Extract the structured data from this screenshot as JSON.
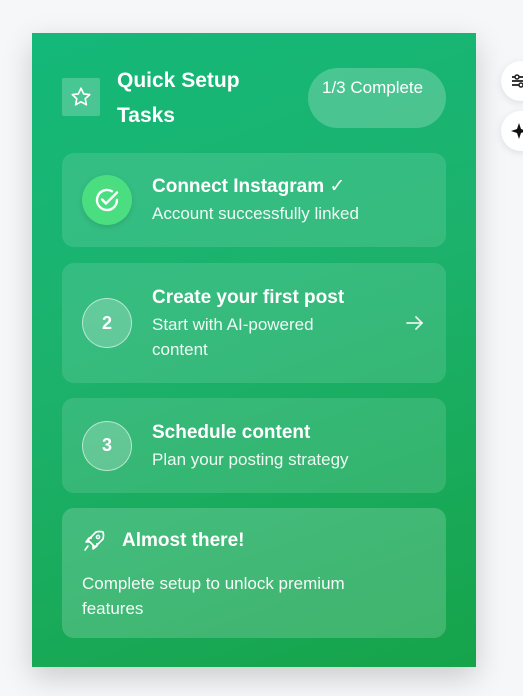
{
  "header": {
    "title": "Quick Setup Tasks",
    "progress": "1/3 Complete",
    "icon": "star-icon"
  },
  "tasks": [
    {
      "status": "done",
      "title": "Connect Instagram ✓",
      "description": "Account successfully linked",
      "icon": "check-circle-icon"
    },
    {
      "status": "pending",
      "number": "2",
      "title": "Create your first post",
      "description": "Start with AI-powered content",
      "icon": "arrow-right-icon"
    },
    {
      "status": "pending",
      "number": "3",
      "title": "Schedule content",
      "description": "Plan your posting strategy"
    }
  ],
  "promo": {
    "title": "Almost there!",
    "description": "Complete setup to unlock premium features",
    "icon": "rocket-icon"
  },
  "side_buttons": [
    "sliders-icon",
    "sparkle-icon"
  ],
  "colors": {
    "card_start": "#14b879",
    "card_end": "#16a34a",
    "done_badge": "#4ade80",
    "page_background": "#f6f7f9"
  }
}
